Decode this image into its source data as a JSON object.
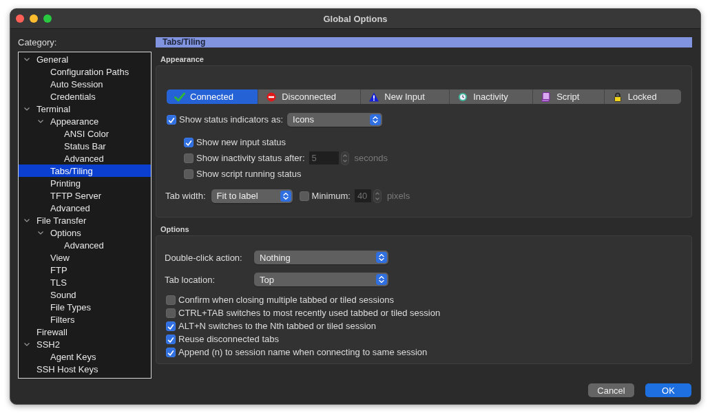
{
  "window": {
    "title": "Global Options"
  },
  "category": {
    "label": "Category:",
    "tree": [
      {
        "label": "General",
        "expanded": true,
        "selected": false,
        "children": [
          {
            "label": "Configuration Paths",
            "selected": false
          },
          {
            "label": "Auto Session",
            "selected": false
          },
          {
            "label": "Credentials",
            "selected": false
          }
        ]
      },
      {
        "label": "Terminal",
        "expanded": true,
        "selected": false,
        "children": [
          {
            "label": "Appearance",
            "expanded": true,
            "selected": false,
            "children": [
              {
                "label": "ANSI Color",
                "selected": false
              },
              {
                "label": "Status Bar",
                "selected": false
              },
              {
                "label": "Advanced",
                "selected": false
              }
            ]
          },
          {
            "label": "Tabs/Tiling",
            "selected": true
          },
          {
            "label": "Printing",
            "selected": false
          },
          {
            "label": "TFTP Server",
            "selected": false
          },
          {
            "label": "Advanced",
            "selected": false
          }
        ]
      },
      {
        "label": "File Transfer",
        "expanded": true,
        "selected": false,
        "children": [
          {
            "label": "Options",
            "expanded": true,
            "selected": false,
            "children": [
              {
                "label": "Advanced",
                "selected": false
              }
            ]
          },
          {
            "label": "View",
            "selected": false
          },
          {
            "label": "FTP",
            "selected": false
          },
          {
            "label": "TLS",
            "selected": false
          },
          {
            "label": "Sound",
            "selected": false
          },
          {
            "label": "File Types",
            "selected": false
          },
          {
            "label": "Filters",
            "selected": false
          }
        ]
      },
      {
        "label": "Firewall",
        "selected": false
      },
      {
        "label": "SSH2",
        "expanded": true,
        "selected": false,
        "children": [
          {
            "label": "Agent Keys",
            "selected": false
          }
        ]
      },
      {
        "label": "SSH Host Keys",
        "selected": false
      }
    ]
  },
  "page": {
    "title": "Tabs/Tiling"
  },
  "appearance": {
    "label": "Appearance",
    "status_tabs": [
      {
        "label": "Connected",
        "kind": "connected",
        "selected": true
      },
      {
        "label": "Disconnected",
        "kind": "disconnected",
        "selected": false
      },
      {
        "label": "New Input",
        "kind": "new-input",
        "selected": false
      },
      {
        "label": "Inactivity",
        "kind": "inactivity",
        "selected": false
      },
      {
        "label": "Script",
        "kind": "script",
        "selected": false
      },
      {
        "label": "Locked",
        "kind": "locked",
        "selected": false
      }
    ],
    "show_indicators": {
      "label": "Show status indicators as:",
      "checked": true,
      "value": "Icons"
    },
    "sub_options": [
      {
        "kind": "check",
        "label": "Show new input status",
        "checked": true
      },
      {
        "kind": "check-number",
        "label": "Show inactivity status after:",
        "checked": false,
        "value": "5",
        "unit": "seconds"
      },
      {
        "kind": "check",
        "label": "Show script running status",
        "checked": false
      }
    ],
    "tab_width": {
      "label": "Tab width:",
      "value": "Fit to label",
      "minimum": {
        "label": "Minimum:",
        "checked": false,
        "value": "40",
        "unit": "pixels"
      }
    }
  },
  "options": {
    "label": "Options",
    "selects": [
      {
        "label": "Double-click action:",
        "value": "Nothing"
      },
      {
        "label": "Tab location:",
        "value": "Top"
      }
    ],
    "checks": [
      {
        "label": "Confirm when closing multiple tabbed or tiled sessions",
        "checked": false
      },
      {
        "label": "CTRL+TAB switches to most recently used tabbed or tiled session",
        "checked": false
      },
      {
        "label": "ALT+N switches to the Nth tabbed or tiled session",
        "checked": true
      },
      {
        "label": "Reuse disconnected tabs",
        "checked": true
      },
      {
        "label": "Append (n) to session name when connecting to same session",
        "checked": true
      }
    ]
  },
  "buttons": [
    {
      "label": "Cancel",
      "kind": "default"
    },
    {
      "label": "OK",
      "kind": "primary"
    }
  ]
}
